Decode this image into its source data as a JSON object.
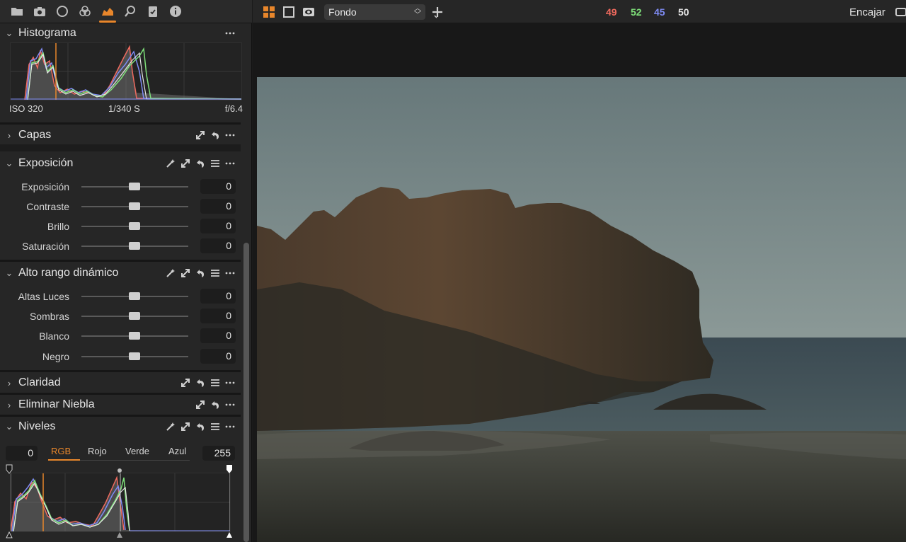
{
  "tool_tabs": [
    {
      "name": "folder-icon"
    },
    {
      "name": "camera-icon"
    },
    {
      "name": "lens-icon"
    },
    {
      "name": "color-icon"
    },
    {
      "name": "exposure-icon",
      "active": true
    },
    {
      "name": "details-icon"
    },
    {
      "name": "metadata-icon"
    },
    {
      "name": "info-icon"
    }
  ],
  "histogram": {
    "title": "Histograma",
    "iso": "ISO 320",
    "shutter": "1/340 S",
    "aperture": "f/6.4"
  },
  "capas": {
    "title": "Capas"
  },
  "exposicion": {
    "title": "Exposición",
    "sliders": [
      {
        "label": "Exposición",
        "value": "0"
      },
      {
        "label": "Contraste",
        "value": "0"
      },
      {
        "label": "Brillo",
        "value": "0"
      },
      {
        "label": "Saturación",
        "value": "0"
      }
    ]
  },
  "hdr": {
    "title": "Alto rango dinámico",
    "sliders": [
      {
        "label": "Altas Luces",
        "value": "0"
      },
      {
        "label": "Sombras",
        "value": "0"
      },
      {
        "label": "Blanco",
        "value": "0"
      },
      {
        "label": "Negro",
        "value": "0"
      }
    ]
  },
  "claridad": {
    "title": "Claridad"
  },
  "niebla": {
    "title": "Eliminar Niebla"
  },
  "niveles": {
    "title": "Niveles",
    "low": "0",
    "high": "255",
    "tabs": [
      "RGB",
      "Rojo",
      "Verde",
      "Azul"
    ],
    "active_tab": "RGB"
  },
  "toolbar": {
    "variant": "Fondo",
    "readout": {
      "r": "49",
      "g": "52",
      "b": "45",
      "l": "50"
    },
    "fit": "Encajar"
  },
  "colors": {
    "accent": "#e8862b",
    "red": "#f06a5e",
    "green": "#7fe07a",
    "blue": "#7f8cf5",
    "white": "#e6e6e6"
  }
}
